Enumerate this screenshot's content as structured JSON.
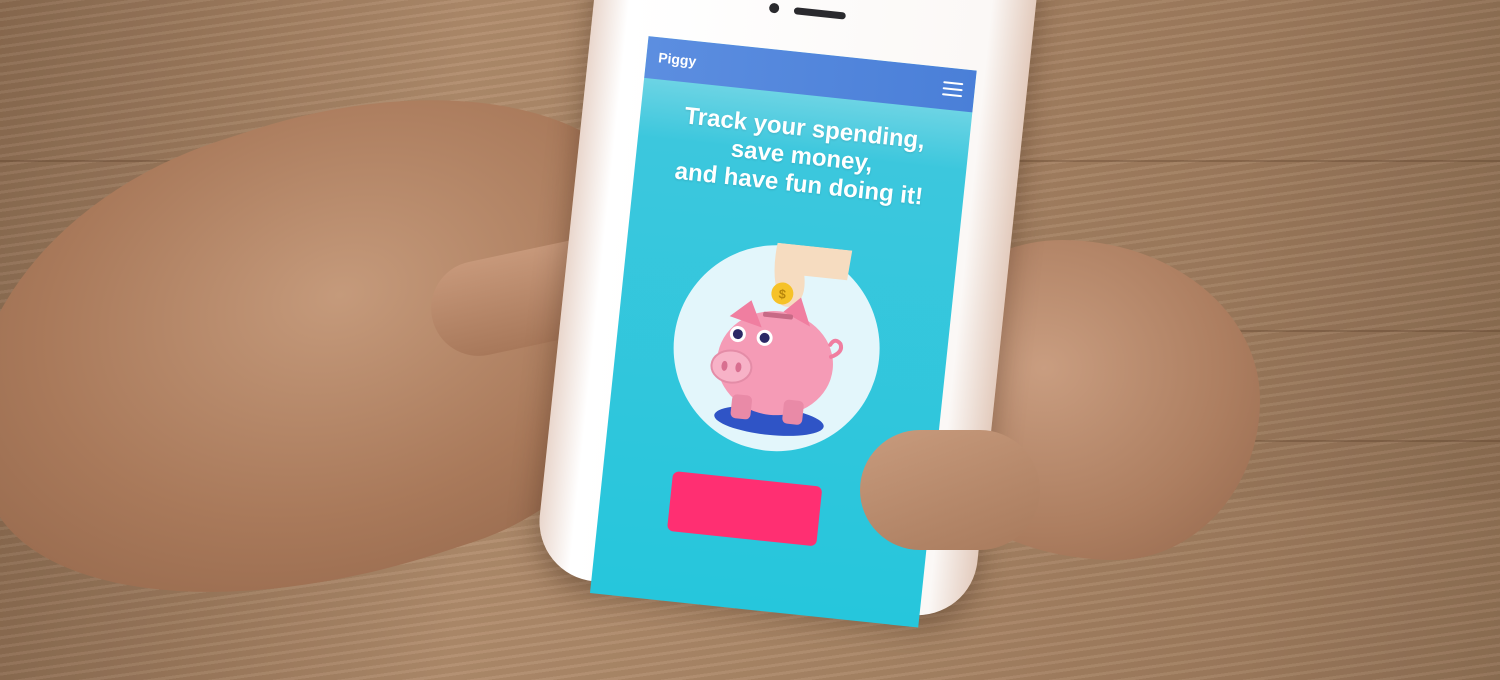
{
  "app": {
    "brand": "Piggy",
    "menu_icon": "hamburger-menu-icon"
  },
  "hero": {
    "lines": [
      "Track your spending,",
      "save money,",
      "and have fun doing it!"
    ]
  },
  "illustration": {
    "name": "piggy-bank-coin-icon",
    "coin_symbol": "$"
  },
  "colors": {
    "navbar": "#4a7fd8",
    "screen_bg": "#26c6dc",
    "cta": "#ff2f72",
    "pig": "#f59bb6"
  }
}
